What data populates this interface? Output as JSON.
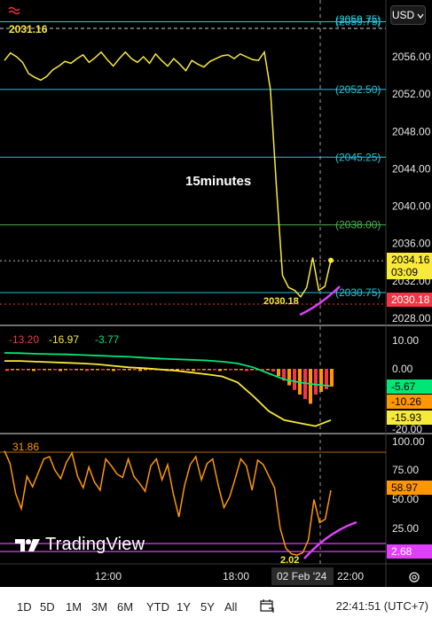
{
  "toolbar": {
    "currency": "USD",
    "top_icon": "wave-icon"
  },
  "annotation": "15minutes",
  "price_pane": {
    "y_ticks": [
      "2056.00",
      "2052.00",
      "2048.00",
      "2044.00",
      "2040.00",
      "2036.00",
      "2032.00",
      "2028.00"
    ],
    "levels": [
      {
        "label": "(2059.75)",
        "value": 2059.75,
        "color": "#26c6da"
      },
      {
        "label": "(2052.50)",
        "value": 2052.5,
        "color": "#26c6da"
      },
      {
        "label": "(2045.25)",
        "value": 2045.25,
        "color": "#26c6da"
      },
      {
        "label": "(2038.00)",
        "value": 2038.0,
        "color": "#4caf50"
      },
      {
        "label": "(2030.75)",
        "value": 2030.75,
        "color": "#26c6da"
      }
    ],
    "high_marker": "2031.16",
    "low_marker": "2030.18",
    "last_price": "2034.16",
    "countdown": "03:09",
    "red_price": "2030.18",
    "colors": {
      "line": "#f9e93a",
      "last_bg": "#f9e93a",
      "red_bg": "#f23645",
      "pink": "#e040fb"
    }
  },
  "macd_pane": {
    "values": [
      "-13.20",
      "-16.97",
      "-3.77"
    ],
    "y_ticks": [
      "10.00",
      "0.00",
      "-20.00"
    ],
    "tags": [
      "-5.67",
      "-10.26",
      "-15.93"
    ],
    "tag_colors": [
      "#00e676",
      "#ff9800",
      "#f9e93a"
    ]
  },
  "rsi_pane": {
    "top_label": "31.86",
    "low_label": "2.02",
    "y_ticks": [
      "100.00",
      "75.00",
      "50.00",
      "25.00"
    ],
    "tags": [
      "58.97",
      "2.68"
    ],
    "tag_colors": [
      "#ff9800",
      "#e040fb"
    ]
  },
  "time_axis": {
    "labels": [
      "12:00",
      "18:00",
      "22:00"
    ],
    "crosshair_date": "02 Feb '24"
  },
  "logo": "TradingView",
  "bottom_bar": {
    "ranges": [
      "1D",
      "5D",
      "1M",
      "3M",
      "6M",
      "YTD",
      "1Y",
      "5Y",
      "All"
    ],
    "time": "22:41:51 (UTC+7)"
  },
  "chart_data": [
    {
      "type": "line",
      "title": "",
      "ylim": [
        2027,
        2062
      ],
      "series": [
        {
          "values": [
            2055.6,
            2056.4,
            2056.0,
            2055.4,
            2054.2,
            2053.8,
            2053.5,
            2053.9,
            2054.6,
            2055.0,
            2055.5,
            2055.3,
            2055.8,
            2056.2,
            2055.4,
            2055.9,
            2056.5,
            2055.7,
            2055.0,
            2055.8,
            2056.5,
            2055.8,
            2055.4,
            2056.0,
            2055.3,
            2056.3,
            2055.6,
            2055.0,
            2055.8,
            2055.2,
            2054.5,
            2055.6,
            2055.2,
            2054.9,
            2055.5,
            2055.8,
            2056.1,
            2056.2,
            2055.8,
            2056.3,
            2056.0,
            2055.7,
            2055.6,
            2056.5,
            2052.5,
            2042.0,
            2032.6,
            2031.3,
            2031.0,
            2030.3,
            2031.3,
            2034.5,
            2031.0,
            2031.4,
            2034.2
          ]
        }
      ]
    },
    {
      "type": "line",
      "ylim": [
        -22,
        12
      ],
      "series": [
        {
          "name": "",
          "values": [
            2.6,
            2.6,
            2.4,
            2.2,
            2.0,
            1.8,
            1.5,
            1.0,
            0.5,
            0.2,
            -0.2,
            -0.6,
            -1.2,
            -1.8,
            -2.5,
            -4.5,
            -9,
            -14,
            -17,
            -18,
            -19,
            -17
          ]
        },
        {
          "name": "",
          "values": [
            5.3,
            5.2,
            5.0,
            4.9,
            4.8,
            4.6,
            4.4,
            4.2,
            4.0,
            3.7,
            3.4,
            3.2,
            3.0,
            2.8,
            2.4,
            1.8,
            0.5,
            -1.5,
            -3.5,
            -4.5,
            -5.2,
            -5.7
          ]
        }
      ]
    },
    {
      "type": "line",
      "ylim": [
        0,
        100
      ],
      "series": [
        {
          "name": "",
          "values": [
            92,
            81,
            55,
            42,
            70,
            61,
            73,
            85,
            87,
            75,
            68,
            82,
            90,
            70,
            60,
            78,
            65,
            58,
            85,
            79,
            72,
            69,
            85,
            70,
            64,
            57,
            79,
            85,
            67,
            80,
            55,
            35,
            62,
            80,
            87,
            67,
            81,
            85,
            62,
            43,
            52,
            68,
            85,
            79,
            58,
            84,
            80,
            70,
            60,
            25,
            8,
            3,
            2,
            4,
            15,
            50,
            30,
            33,
            58
          ]
        }
      ]
    }
  ]
}
